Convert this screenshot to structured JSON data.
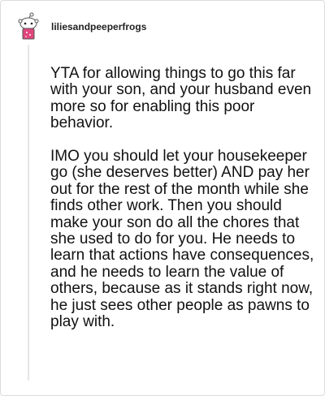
{
  "comment": {
    "username": "liliesandpeeperfrogs",
    "avatar_icon": "snoo-avatar-icon",
    "paragraphs": [
      "YTA for allowing things to go this far with your son, and your husband even more so for enabling this poor behavior.",
      "IMO you should let your housekeeper go (she deserves better) AND pay her out for the rest of the month while she finds other work. Then you should make your son do all the chores that she used to do for you. He needs to learn that actions have consequences, and he needs to learn the value of others, because as it stands right now, he just sees other people as pawns to play with."
    ]
  },
  "colors": {
    "avatar_body": "#e8e8e8",
    "avatar_shirt": "#e0457b",
    "thread_line": "#e6e6e6"
  }
}
